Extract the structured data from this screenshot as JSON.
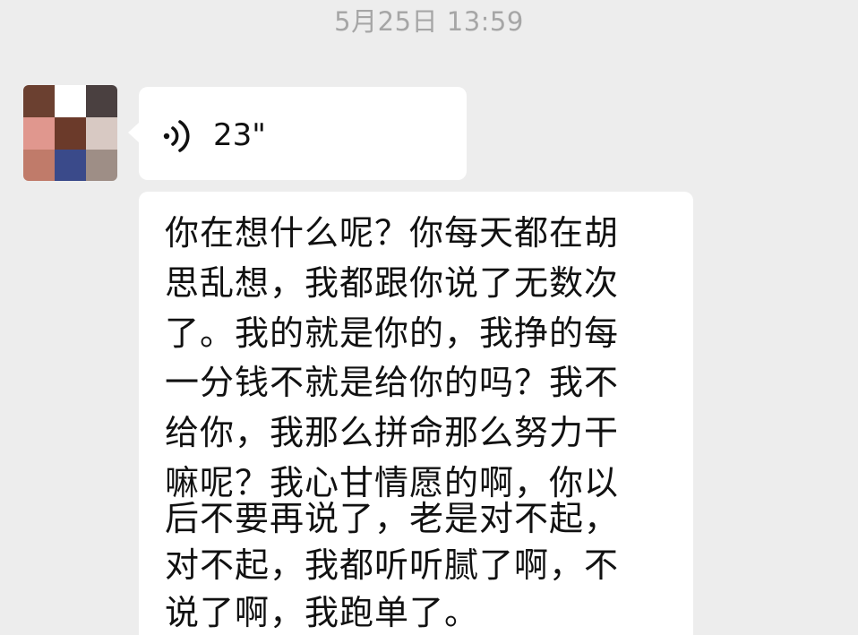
{
  "chat": {
    "timestamp": "5月25日 13:59",
    "avatar": {
      "colors": [
        "#6b4030",
        "#ffffff",
        "#4a4040",
        "#e0978e",
        "#6b3a2a",
        "#d8c9c3",
        "#c07b6a",
        "#3a4a8a",
        "#9e8e86"
      ]
    },
    "voice_message": {
      "icon": "voice-wave-icon",
      "duration": "23\""
    },
    "text_message": {
      "lines": [
        "你在想什么呢？你每天都在胡",
        "思乱想，我都跟你说了无数次",
        "了。我的就是你的，我挣的每",
        "一分钱不就是给你的吗？我不",
        "给你，我那么拼命那么努力干",
        "嘛呢？我心甘情愿的啊，你以",
        "后不要再说了，老是对不起，",
        "对不起，我都听听腻了啊，不",
        "说了啊，我跑单了。"
      ]
    }
  }
}
